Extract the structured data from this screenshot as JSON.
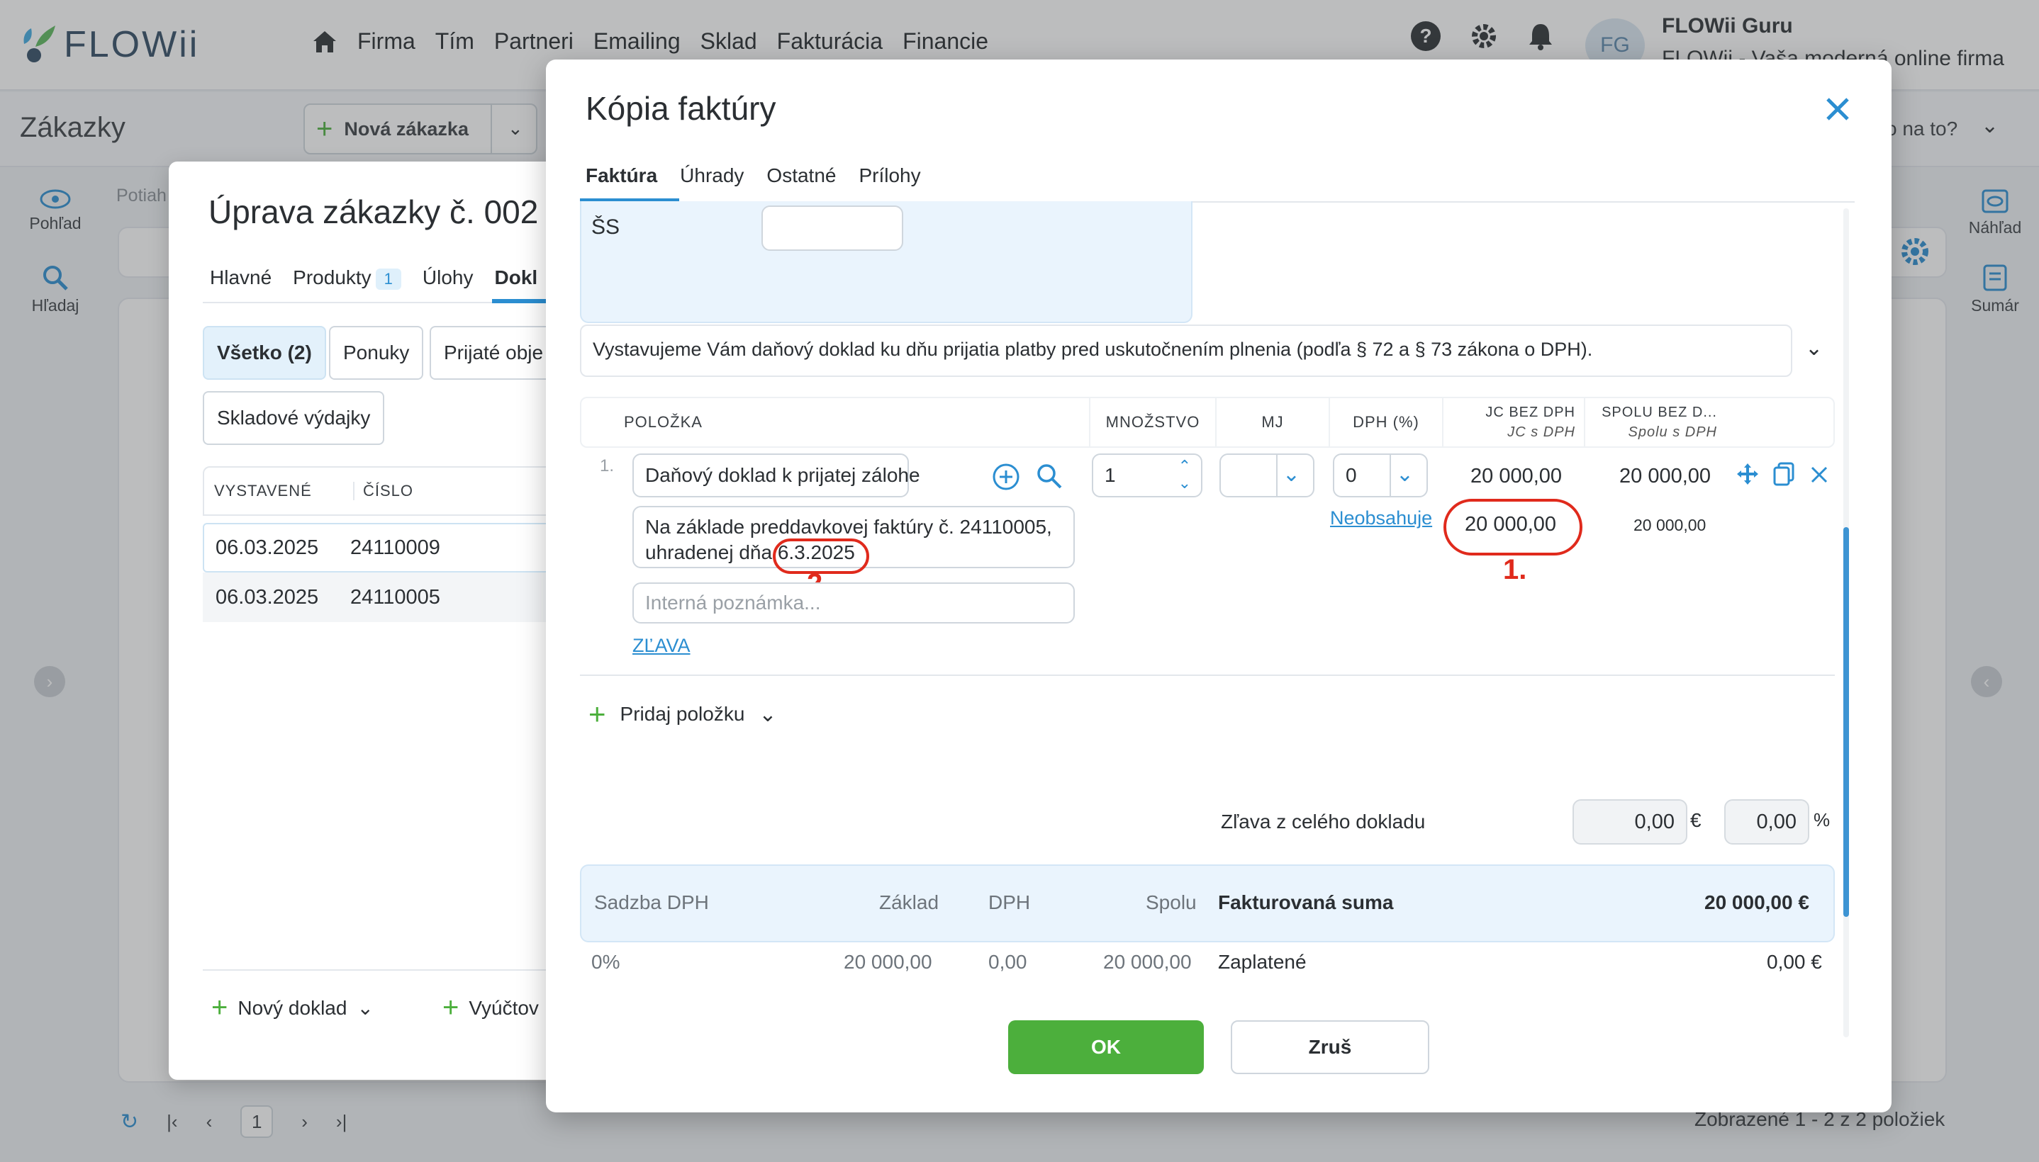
{
  "app": {
    "brand": "FLOWii",
    "nav": [
      "Firma",
      "Tím",
      "Partneri",
      "Emailing",
      "Sklad",
      "Fakturácia",
      "Financie"
    ],
    "user_initials": "FG",
    "user_name": "FLOWii Guru",
    "user_sub": "FLOWii - Vaša moderná online firma",
    "page_title": "Zákazky",
    "new_order": "Nová zákazka",
    "help_text": "o na to?",
    "left_rail": [
      "Pohľad",
      "Hľadaj"
    ],
    "right_rail": [
      "Náhľad",
      "Sumár"
    ],
    "filter_hint": "Potiah",
    "pager_current": "1",
    "shown_text": "Zobrazené 1 - 2 z 2 položiek"
  },
  "order_dialog": {
    "title": "Úprava zákazky č. 002",
    "tabs": [
      "Hlavné",
      "Produkty",
      "Úlohy",
      "Dokl"
    ],
    "products_badge": "1",
    "filters": [
      "Všetko (2)",
      "Ponuky",
      "Prijaté obje",
      "Skladové výdajky"
    ],
    "columns": [
      "VYSTAVENÉ",
      "ČÍSLO"
    ],
    "rows": [
      {
        "date": "06.03.2025",
        "number": "24110009"
      },
      {
        "date": "06.03.2025",
        "number": "24110005"
      }
    ],
    "new_doc": "Nový doklad",
    "billing": "Vyúčtov"
  },
  "invoice": {
    "title": "Kópia faktúry",
    "tabs": [
      "Faktúra",
      "Úhrady",
      "Ostatné",
      "Prílohy"
    ],
    "ss_label": "ŠS",
    "note": "Vystavujeme Vám daňový doklad ku dňu prijatia platby pred uskutočnením plnenia (podľa § 72 a § 73 zákona o DPH).",
    "columns": {
      "item": "POLOŽKA",
      "qty": "MNOŽSTVO",
      "unit": "MJ",
      "vat": "DPH (%)",
      "unit_price": "JC BEZ DPH",
      "unit_price_vat": "JC s DPH",
      "total": "SPOLU BEZ D...",
      "total_vat": "Spolu s DPH"
    },
    "line": {
      "index": "1.",
      "name": "Daňový doklad k prijatej zálohe",
      "description_line1": "Na základe preddavkovej faktúry č. 24110005,",
      "description_prefix": "uhradenej dňa ",
      "description_date": "6.3.2025",
      "internal_placeholder": "Interná poznámka...",
      "discount_link": "ZĽAVA",
      "qty": "1",
      "vat": "0",
      "vat_content": "Neobsahuje",
      "unit_price": "20 000,00",
      "unit_price_vat": "20 000,00",
      "total": "20 000,00",
      "total_vat": "20 000,00"
    },
    "annotations": [
      "1.",
      "2."
    ],
    "add_item": "Pridaj položku",
    "doc_discount_label": "Zľava z celého dokladu",
    "doc_discount_amount": "0,00",
    "doc_discount_currency": "€",
    "doc_discount_pct": "0,00",
    "doc_discount_pct_sign": "%",
    "summary": {
      "headers": [
        "Sadzba DPH",
        "Základ",
        "DPH",
        "Spolu"
      ],
      "invoiced_label": "Fakturovaná suma",
      "invoiced_value": "20 000,00 €",
      "rate": "0%",
      "base": "20 000,00",
      "vat": "0,00",
      "total": "20 000,00",
      "paid_label": "Zaplatené",
      "paid_value": "0,00 €"
    },
    "ok": "OK",
    "cancel": "Zruš"
  },
  "colors": {
    "accent": "#2b8ed1",
    "ok_green": "#4caf3c",
    "annotation_red": "#e02a1c",
    "logo_blue": "#2f4a63"
  }
}
